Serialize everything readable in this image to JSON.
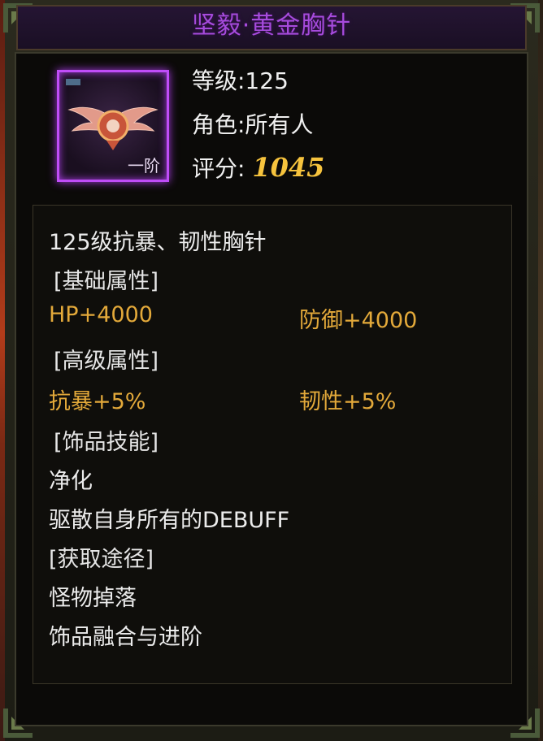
{
  "title": "坚毅·黄金胸针",
  "item": {
    "tier_label": "一阶",
    "level_label": "等级:125",
    "role_label": "角色:所有人",
    "score_label": "评分:",
    "score_value": "1045"
  },
  "description": {
    "summary": "125级抗暴、韧性胸针",
    "basic_header": "[基础属性]",
    "basic_attrs": [
      "HP+4000",
      "防御+4000"
    ],
    "advanced_header": "[高级属性]",
    "advanced_attrs": [
      "抗暴+5%",
      "韧性+5%"
    ],
    "skill_header": "[饰品技能]",
    "skill_name": "净化",
    "skill_desc": "驱散自身所有的DEBUFF",
    "source_header": "[获取途径]",
    "sources": [
      "怪物掉落",
      "饰品融合与进阶"
    ]
  },
  "colors": {
    "title": "#a64bdc",
    "score": "#f6c33d",
    "attribute": "#e3a93a",
    "frame_glow": "#c04df8"
  }
}
